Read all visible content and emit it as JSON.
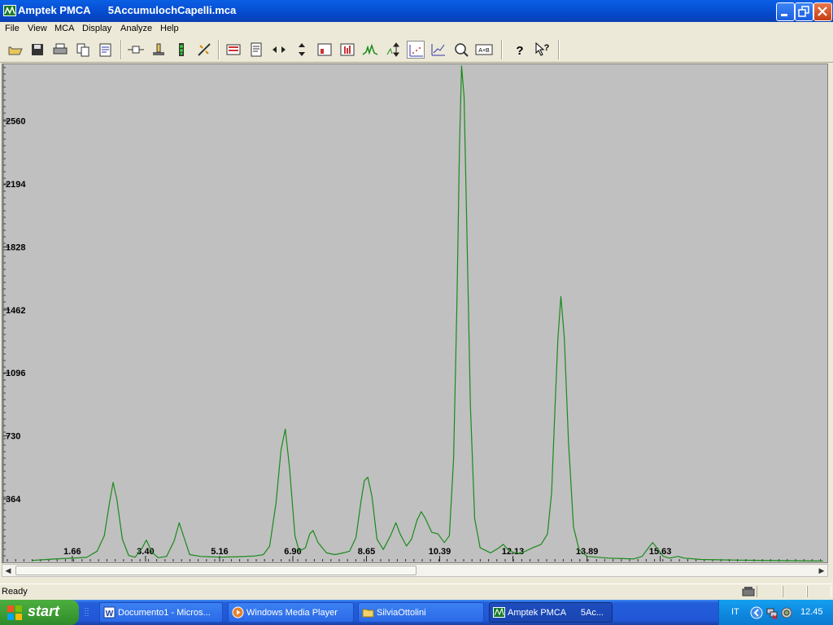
{
  "window": {
    "app_name": "Amptek PMCA",
    "file_name": "5AccumulochCapelli.mca"
  },
  "menu": [
    "File",
    "View",
    "MCA",
    "Display",
    "Analyze",
    "Help"
  ],
  "toolbar": {
    "buttons": [
      "open-icon",
      "save-icon",
      "print-icon",
      "copy-icon",
      "properties-icon",
      "connect-icon",
      "acquire-setup-icon",
      "traffic-light-icon",
      "calibrate-icon",
      "color-bars-icon",
      "notes-icon",
      "horizontal-zoom-icon",
      "vertical-zoom-icon",
      "roi-icon",
      "bar-mode-icon",
      "peak-icon",
      "auto-scale-icon",
      "dot-mode-icon",
      "line-mode-icon",
      "zoom-in-icon",
      "a-plus-b-icon"
    ],
    "help_labels": [
      "?",
      "?"
    ],
    "ab_label": "A+B"
  },
  "chart_data": {
    "type": "line",
    "title": "",
    "xlabel": "",
    "ylabel": "",
    "xlim": [
      0,
      19.6
    ],
    "ylim": [
      0,
      2880
    ],
    "y_ticks": [
      "364",
      "730",
      "1096",
      "1462",
      "1828",
      "2194",
      "2560"
    ],
    "x_ticks": [
      "1.66",
      "3.40",
      "5.16",
      "6.90",
      "8.65",
      "10.39",
      "12.13",
      "13.89",
      "15.63"
    ],
    "line_color": "#1a8a1a",
    "background": "#c0c0c0",
    "series": [
      {
        "points": [
          [
            0.7,
            6
          ],
          [
            1.2,
            14
          ],
          [
            1.66,
            20
          ],
          [
            2.0,
            24
          ],
          [
            2.25,
            60
          ],
          [
            2.42,
            150
          ],
          [
            2.55,
            350
          ],
          [
            2.63,
            460
          ],
          [
            2.72,
            360
          ],
          [
            2.85,
            130
          ],
          [
            3.0,
            35
          ],
          [
            3.15,
            25
          ],
          [
            3.3,
            70
          ],
          [
            3.42,
            125
          ],
          [
            3.55,
            55
          ],
          [
            3.7,
            22
          ],
          [
            3.9,
            30
          ],
          [
            4.08,
            120
          ],
          [
            4.2,
            225
          ],
          [
            4.3,
            150
          ],
          [
            4.45,
            40
          ],
          [
            4.7,
            30
          ],
          [
            5.16,
            25
          ],
          [
            5.6,
            28
          ],
          [
            6.0,
            32
          ],
          [
            6.2,
            40
          ],
          [
            6.35,
            90
          ],
          [
            6.5,
            340
          ],
          [
            6.62,
            650
          ],
          [
            6.72,
            770
          ],
          [
            6.82,
            550
          ],
          [
            6.95,
            150
          ],
          [
            7.05,
            60
          ],
          [
            7.2,
            80
          ],
          [
            7.3,
            160
          ],
          [
            7.38,
            180
          ],
          [
            7.5,
            110
          ],
          [
            7.7,
            50
          ],
          [
            7.9,
            40
          ],
          [
            8.1,
            50
          ],
          [
            8.25,
            60
          ],
          [
            8.4,
            140
          ],
          [
            8.52,
            350
          ],
          [
            8.6,
            470
          ],
          [
            8.68,
            490
          ],
          [
            8.78,
            380
          ],
          [
            8.9,
            130
          ],
          [
            9.05,
            70
          ],
          [
            9.22,
            150
          ],
          [
            9.35,
            225
          ],
          [
            9.45,
            160
          ],
          [
            9.6,
            90
          ],
          [
            9.72,
            130
          ],
          [
            9.85,
            240
          ],
          [
            9.95,
            290
          ],
          [
            10.05,
            250
          ],
          [
            10.2,
            170
          ],
          [
            10.35,
            160
          ],
          [
            10.5,
            110
          ],
          [
            10.62,
            150
          ],
          [
            10.72,
            600
          ],
          [
            10.8,
            1500
          ],
          [
            10.86,
            2400
          ],
          [
            10.91,
            2880
          ],
          [
            10.97,
            2700
          ],
          [
            11.03,
            2000
          ],
          [
            11.12,
            900
          ],
          [
            11.22,
            250
          ],
          [
            11.35,
            80
          ],
          [
            11.6,
            50
          ],
          [
            11.8,
            80
          ],
          [
            11.9,
            100
          ],
          [
            12.05,
            60
          ],
          [
            12.3,
            45
          ],
          [
            12.6,
            80
          ],
          [
            12.8,
            100
          ],
          [
            12.95,
            160
          ],
          [
            13.05,
            400
          ],
          [
            13.13,
            900
          ],
          [
            13.2,
            1300
          ],
          [
            13.27,
            1540
          ],
          [
            13.35,
            1300
          ],
          [
            13.45,
            700
          ],
          [
            13.57,
            200
          ],
          [
            13.7,
            70
          ],
          [
            13.89,
            30
          ],
          [
            14.4,
            20
          ],
          [
            15.0,
            15
          ],
          [
            15.2,
            30
          ],
          [
            15.35,
            80
          ],
          [
            15.45,
            110
          ],
          [
            15.55,
            80
          ],
          [
            15.7,
            30
          ],
          [
            15.85,
            20
          ],
          [
            16.05,
            30
          ],
          [
            16.2,
            20
          ],
          [
            16.6,
            12
          ],
          [
            17.5,
            8
          ],
          [
            18.5,
            5
          ],
          [
            19.5,
            3
          ]
        ]
      }
    ]
  },
  "status": {
    "text": "Ready"
  },
  "taskbar": {
    "start_label": "start",
    "tasks": [
      {
        "label": "Documento1 - Micros...",
        "icon": "word-icon",
        "active": false
      },
      {
        "label": "Windows Media Player",
        "icon": "media-player-icon",
        "active": false
      },
      {
        "label": "SilviaOttolini",
        "icon": "folder-icon",
        "active": false
      },
      {
        "label": "Amptek PMCA      5Ac...",
        "icon": "pmca-icon",
        "active": true
      }
    ],
    "tray_language": "IT",
    "clock": "12.45"
  }
}
